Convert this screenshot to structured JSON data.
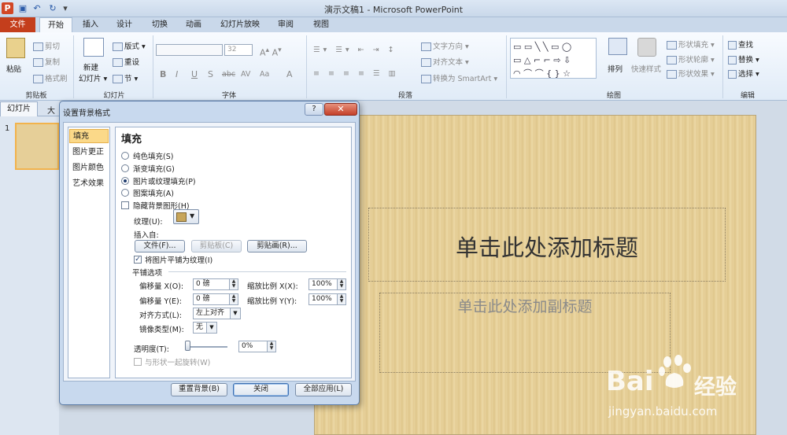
{
  "window": {
    "title": "演示文稿1 - Microsoft PowerPoint",
    "app_icon": "P"
  },
  "quick_access": {
    "save_icon": "save-icon",
    "undo_icon": "undo-icon",
    "redo_icon": "redo-icon",
    "customize_icon": "customize-icon"
  },
  "tabs": {
    "file": "文件",
    "home": "开始",
    "insert": "插入",
    "design": "设计",
    "transitions": "切换",
    "animations": "动画",
    "slideshow": "幻灯片放映",
    "review": "审阅",
    "view": "视图"
  },
  "ribbon": {
    "clipboard": {
      "label": "剪贴板",
      "paste": "粘贴",
      "cut": "剪切",
      "copy": "复制",
      "format_painter": "格式刷"
    },
    "slides": {
      "label": "幻灯片",
      "new_slide": "新建",
      "new_slide2": "幻灯片 ▾",
      "layout": "版式 ▾",
      "reset": "重设",
      "section": "节 ▾"
    },
    "font": {
      "label": "字体",
      "size": "32",
      "bold": "B",
      "italic": "I",
      "underline": "U",
      "shadow": "S",
      "strike": "abc",
      "spacing": "AV",
      "case": "Aa",
      "clear": "A",
      "color": "A"
    },
    "paragraph": {
      "label": "段落",
      "text_direction": "文字方向 ▾",
      "align_text": "对齐文本 ▾",
      "smartart": "转换为 SmartArt ▾"
    },
    "drawing": {
      "label": "绘图",
      "arrange": "排列",
      "quick_styles": "快速样式",
      "shape_fill": "形状填充 ▾",
      "shape_outline": "形状轮廓 ▾",
      "shape_effects": "形状效果 ▾"
    },
    "editing": {
      "label": "编辑",
      "find": "查找",
      "replace": "替换 ▾",
      "select": "选择 ▾"
    }
  },
  "panel": {
    "slides_tab": "幻灯片",
    "outline_tab": "大",
    "slide_number": "1"
  },
  "slide": {
    "title": "单击此处添加标题",
    "subtitle": "单击此处添加副标题"
  },
  "dialog": {
    "title": "设置背景格式",
    "help": "?",
    "close": "✕",
    "nav": [
      "填充",
      "图片更正",
      "图片颜色",
      "艺术效果"
    ],
    "heading": "填充",
    "options": [
      {
        "label": "纯色填充(S)",
        "selected": false
      },
      {
        "label": "渐变填充(G)",
        "selected": false
      },
      {
        "label": "图片或纹理填充(P)",
        "selected": true
      },
      {
        "label": "图案填充(A)",
        "selected": false
      }
    ],
    "hide_bg": "隐藏背景图形(H)",
    "texture_label": "纹理(U):",
    "insert_from": "插入自:",
    "file_btn": "文件(F)...",
    "clipboard_btn": "剪贴板(C)",
    "clipart_btn": "剪贴画(R)...",
    "tile_chk": "将图片平铺为纹理(I)",
    "tiling_options": "平铺选项",
    "offset_x_label": "偏移量 X(O):",
    "offset_x": "0 磅",
    "scale_x_label": "缩放比例 X(X):",
    "scale_x": "100%",
    "offset_y_label": "偏移量 Y(E):",
    "offset_y": "0 磅",
    "scale_y_label": "缩放比例 Y(Y):",
    "scale_y": "100%",
    "align_label": "对齐方式(L):",
    "align": "左上对齐",
    "mirror_label": "镜像类型(M):",
    "mirror": "无",
    "transparency_label": "透明度(T):",
    "transparency": "0%",
    "rotate_chk": "与形状一起旋转(W)",
    "reset_btn": "重置背景(B)",
    "close_btn": "关闭",
    "apply_all_btn": "全部应用(L)"
  },
  "watermark": {
    "brand": "Bai",
    "brand2": "经验",
    "url": "jingyan.baidu.com"
  }
}
